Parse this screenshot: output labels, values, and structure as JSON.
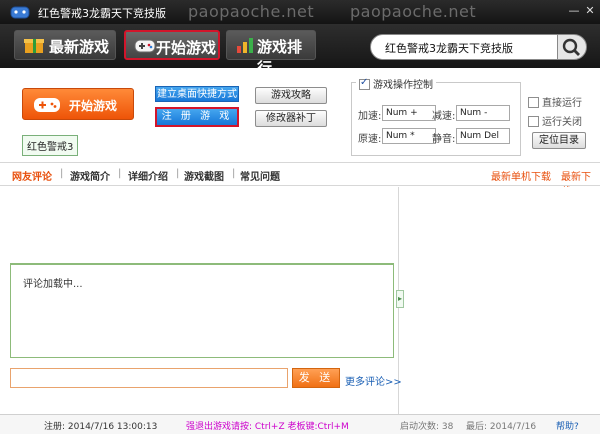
{
  "window": {
    "title": "红色警戒3龙霸天下竞技版",
    "watermark": "paopaoche.net",
    "controls": {
      "minimize": "—",
      "close": "✕"
    }
  },
  "toolbar": {
    "latest_games": "最新游戏",
    "start_game": "开始游戏",
    "game_ranking": "游戏排行"
  },
  "search": {
    "value": "红色警戒3龙霸天下竞技版",
    "icon": "search-icon"
  },
  "panel": {
    "start_button": "开始游戏",
    "game_tag": "红色警戒3",
    "create_shortcut": "建立桌面快捷方式",
    "register_game": "注 册 游 戏",
    "game_guide": "游戏攻略",
    "modifier_patch": "修改器补丁",
    "control_title": "游戏操作控制",
    "control_checked": true,
    "keys": [
      {
        "label": "加速:",
        "value": "Num +"
      },
      {
        "label": "减速:",
        "value": "Num -"
      },
      {
        "label": "原速:",
        "value": "Num *"
      },
      {
        "label": "静音:",
        "value": "Num Del"
      }
    ],
    "direct_run": "直接运行",
    "run_close": "运行关闭",
    "locate_dir": "定位目录"
  },
  "tabs": [
    "网友评论",
    "游戏简介",
    "详细介绍",
    "游戏截图",
    "常见问题"
  ],
  "tab_separator": "|",
  "right_links": [
    "最新单机下载",
    "最新下载"
  ],
  "comments": {
    "loading": "评论加载中...",
    "send": "发 送",
    "more": "更多评论>>",
    "handle": "▸"
  },
  "status": {
    "register": "注册: 2014/7/16 13:00:13",
    "hint": "强退出游戏请按: Ctrl+Z 老板键:Ctrl+M",
    "launch_count": "启动次数: 38",
    "last": "最后: 2014/7/16",
    "help": "帮助?"
  },
  "colors": {
    "accent": "#ee5408",
    "active_border": "#d2152b",
    "link": "#1a5fb4",
    "hint": "#cc00cc"
  }
}
